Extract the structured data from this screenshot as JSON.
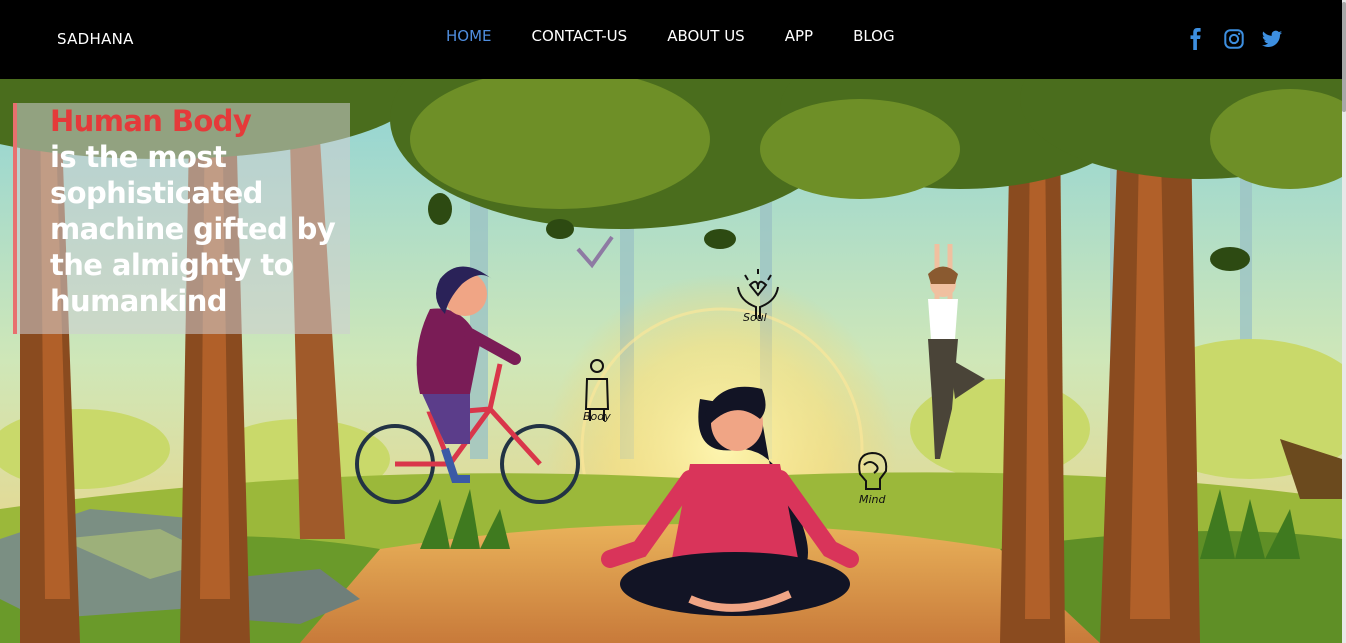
{
  "navbar": {
    "brand": "SADHANA",
    "links": [
      {
        "label": "HOME",
        "active": true
      },
      {
        "label": "CONTACT-US",
        "active": false
      },
      {
        "label": "ABOUT US",
        "active": false
      },
      {
        "label": "APP",
        "active": false
      },
      {
        "label": "BLOG",
        "active": false
      }
    ],
    "socials": [
      "facebook-icon",
      "instagram-icon",
      "twitter-icon"
    ],
    "active_color": "#4f8dde",
    "social_color": "#3d8fe0"
  },
  "hero": {
    "highlight": "Human Body",
    "text": "is the most sophisticated machine gifted by the almighty to humankind",
    "highlight_color": "#e53a3a",
    "accent_border": "#e8706f",
    "labels": {
      "soul": "Soul",
      "body": "Body",
      "mind": "Mind"
    }
  }
}
